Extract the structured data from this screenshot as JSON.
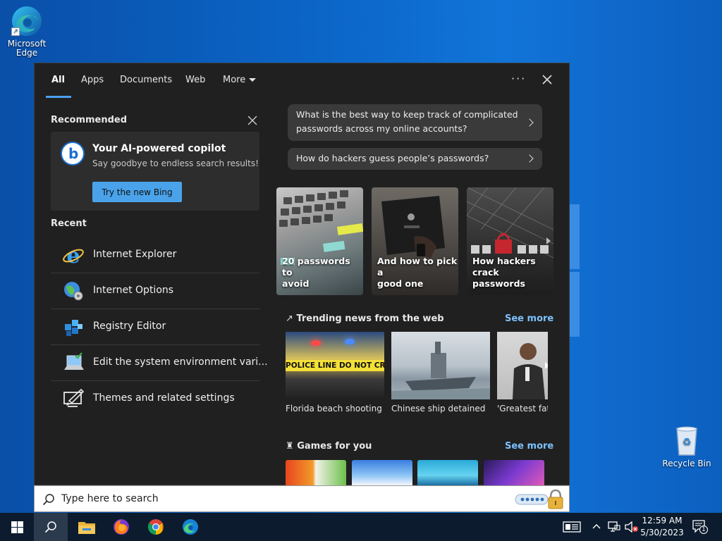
{
  "desktop": {
    "icons": [
      {
        "label": "Microsoft\nEdge"
      },
      {
        "label": "Recycle Bin"
      }
    ]
  },
  "tabs": [
    {
      "label": "All"
    },
    {
      "label": "Apps"
    },
    {
      "label": "Documents"
    },
    {
      "label": "Web"
    },
    {
      "label": "More"
    }
  ],
  "recommended": {
    "title": "Recommended",
    "card": {
      "title": "Your AI-powered copilot",
      "subtitle": "Say goodbye to endless search results!",
      "button": "Try the new Bing"
    }
  },
  "recent": {
    "title": "Recent",
    "items": [
      {
        "label": "Internet Explorer"
      },
      {
        "label": "Internet Options"
      },
      {
        "label": "Registry Editor"
      },
      {
        "label": "Edit the system environment vari..."
      },
      {
        "label": "Themes and related settings"
      }
    ]
  },
  "suggestions": [
    {
      "line1": "What is the best way to keep track of complicated",
      "line2": "passwords across my online accounts?"
    },
    {
      "line1": "How do hackers guess people’s passwords?"
    }
  ],
  "tiles": [
    {
      "line1": "20 passwords to",
      "line2": "avoid"
    },
    {
      "line1": "And how to pick a",
      "line2": "good one"
    },
    {
      "line1": "How hackers",
      "line2": "crack passwords"
    }
  ],
  "trending": {
    "title": "Trending news from the web",
    "see_more": "See more",
    "items": [
      {
        "caption": "Florida beach shooting",
        "image_text": "POLICE LINE DO NOT CROSS"
      },
      {
        "caption": "Chinese ship detained"
      },
      {
        "caption": "'Greatest fath"
      }
    ]
  },
  "games": {
    "title": "Games for you",
    "see_more": "See more"
  },
  "search": {
    "placeholder": "Type here to search"
  },
  "taskbar": {
    "time": "12:59 AM",
    "date": "5/30/2023",
    "notification_count": "1"
  },
  "colors": {
    "accent": "#4aa3ea",
    "link": "#7cc2ff",
    "panel_bg": "#202020"
  }
}
